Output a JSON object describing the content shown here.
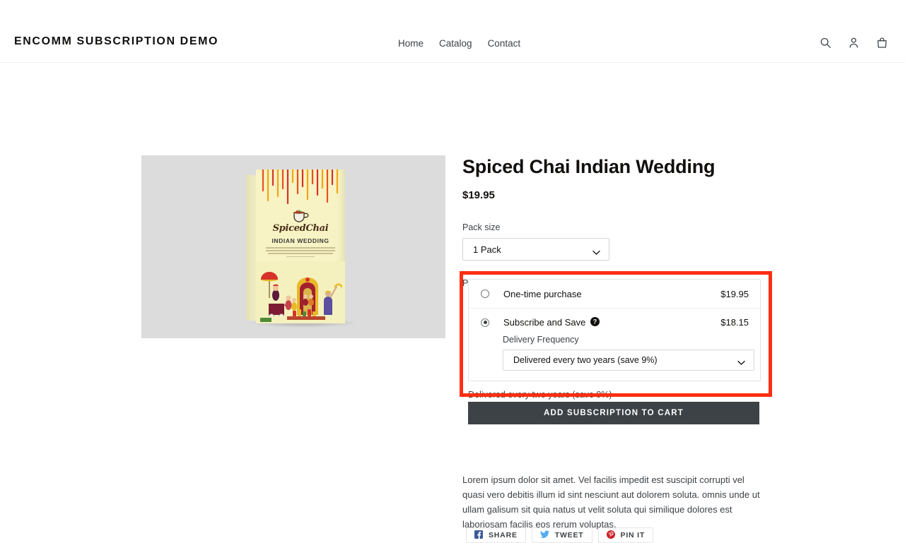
{
  "header": {
    "brand": "ENCOMM SUBSCRIPTION DEMO",
    "nav": [
      {
        "label": "Home"
      },
      {
        "label": "Catalog"
      },
      {
        "label": "Contact"
      }
    ],
    "icons": [
      {
        "name": "search-icon"
      },
      {
        "name": "account-icon"
      },
      {
        "name": "cart-icon"
      }
    ]
  },
  "product": {
    "title": "Spiced Chai Indian Wedding",
    "price": "$19.95",
    "image": {
      "brand_logo": "SpicedChai",
      "box_title": "INDIAN WEDDING",
      "background_color": "#dcdcdc",
      "box_color": "#f7f3c4"
    },
    "pack_size": {
      "label": "Pack size",
      "value": "1 Pack",
      "chevron": "chevron-down-icon"
    },
    "purchase_options": {
      "label": "Purchase options",
      "highlight_color": "#fd2e11",
      "options": [
        {
          "id": "one-time",
          "label": "One-time purchase",
          "price": "$19.95",
          "selected": false
        },
        {
          "id": "subscribe",
          "label": "Subscribe and Save",
          "help_icon": "help-icon",
          "price": "$18.15",
          "selected": true
        }
      ],
      "delivery_frequency": {
        "label": "Delivery Frequency",
        "value": "Delivered every two years (save 9%)",
        "chevron": "chevron-down-icon"
      }
    },
    "frequency_note": "Delivered every two years (save 9%)",
    "add_to_cart_label": "ADD SUBSCRIPTION TO CART",
    "description": "Lorem ipsum dolor sit amet. Vel facilis impedit est suscipit corrupti vel quasi vero debitis illum id sint nesciunt aut dolorem soluta.  omnis unde ut ullam galisum sit quia natus ut velit soluta qui similique dolores est laboriosam facilis eos rerum voluptas."
  },
  "share": {
    "buttons": [
      {
        "label": "SHARE",
        "icon": "facebook-icon",
        "color": "#3b5998"
      },
      {
        "label": "TWEET",
        "icon": "twitter-icon",
        "color": "#55acee"
      },
      {
        "label": "PIN IT",
        "icon": "pinterest-icon",
        "color": "#cb2027"
      }
    ]
  }
}
